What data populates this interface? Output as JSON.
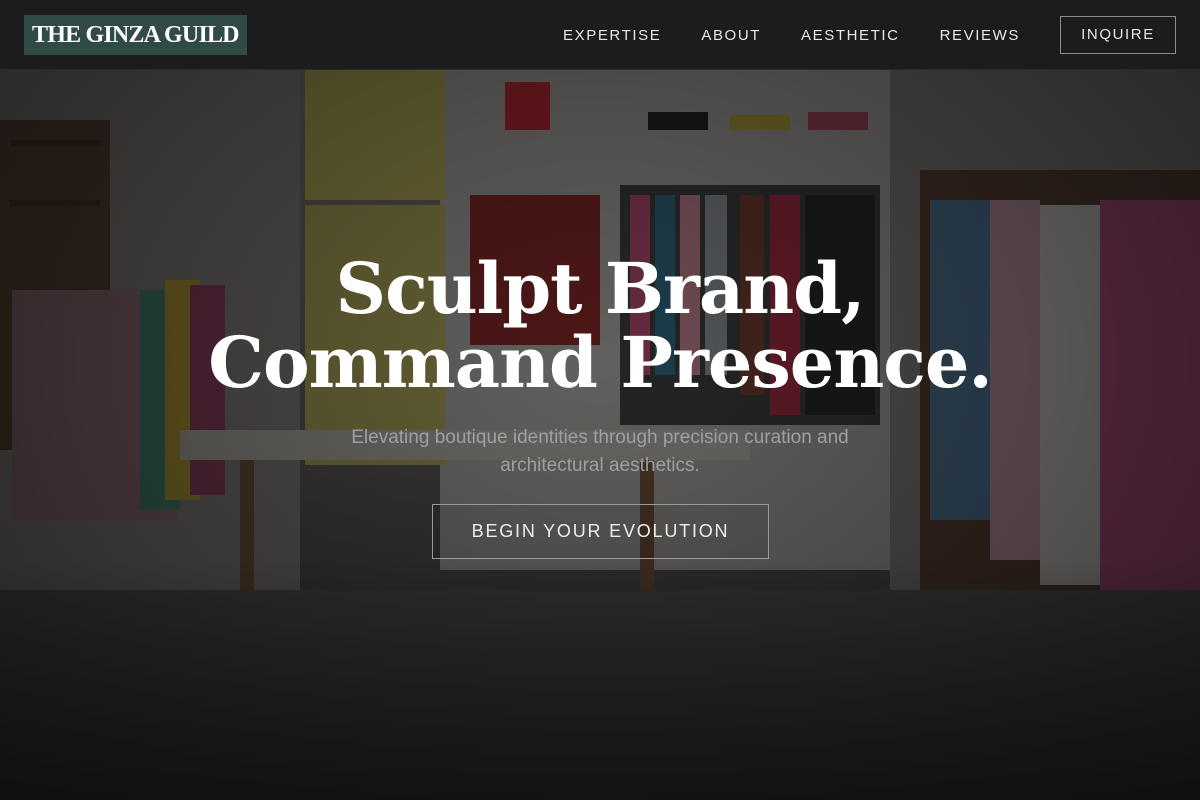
{
  "navbar": {
    "logo": "THE GINZA GUILD",
    "links": [
      "EXPERTISE",
      "ABOUT",
      "AESTHETIC",
      "REVIEWS"
    ],
    "cta_label": "INQUIRE"
  },
  "hero": {
    "title_line1": "Sculpt Brand,",
    "title_line2": "Command Presence.",
    "subtitle": "Elevating boutique identities through precision curation and architectural aesthetics.",
    "cta_label": "BEGIN YOUR EVOLUTION"
  },
  "colors": {
    "navbar_bg": "#1c1c1c",
    "logo_bg": "#2f4a47",
    "text_primary": "#ffffff",
    "text_muted": "#9aa0a6"
  }
}
